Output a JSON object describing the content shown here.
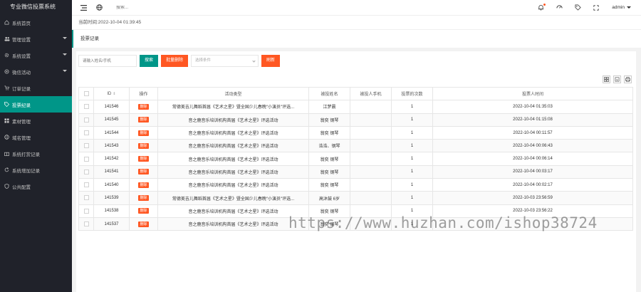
{
  "sidebar": {
    "title": "专业微信投票系统",
    "items": [
      {
        "label": "系统首页",
        "icon": "home-icon",
        "arrow": false,
        "active": false
      },
      {
        "label": "管理设置",
        "icon": "users-icon",
        "arrow": true,
        "active": false
      },
      {
        "label": "系统设置",
        "icon": "gear-icon",
        "arrow": true,
        "active": false
      },
      {
        "label": "微信活动",
        "icon": "settings-icon",
        "arrow": true,
        "active": false
      },
      {
        "label": "订单记录",
        "icon": "cart-icon",
        "arrow": false,
        "active": false
      },
      {
        "label": "投票纪录",
        "icon": "tag-icon",
        "arrow": false,
        "active": true
      },
      {
        "label": "素材管理",
        "icon": "grid-icon",
        "arrow": false,
        "active": false
      },
      {
        "label": "域名管理",
        "icon": "globe-icon",
        "arrow": false,
        "active": false
      },
      {
        "label": "系统打赏记录",
        "icon": "gift-icon",
        "arrow": false,
        "active": false
      },
      {
        "label": "系统增加记录",
        "icon": "refresh-icon",
        "arrow": false,
        "active": false
      },
      {
        "label": "公共配置",
        "icon": "shield-icon",
        "arrow": false,
        "active": false
      }
    ]
  },
  "topbar": {
    "search_placeholder": "搜索...",
    "user": "admin"
  },
  "timebar": {
    "text": "当前时间:2022-10-04 01:39:45"
  },
  "tab": {
    "label": "投票记录"
  },
  "filter": {
    "name_placeholder": "请输入姓名/手机",
    "search_label": "搜索",
    "batch_delete_label": "批量删除",
    "select_placeholder": "选择条件",
    "refresh_label": "刷新"
  },
  "table": {
    "headers": [
      "ID",
      "操作",
      "活动类型",
      "被投姓名",
      "被投人手机",
      "投票的次数",
      "投票人时间"
    ],
    "delete_label": "删除",
    "rows": [
      {
        "id": "141546",
        "activity": "常德美吉儿舞蹈首届《艺术之星》暨全国少儿春晚\"小演员\"评选...",
        "name": "江梦晨",
        "phone": "",
        "count": "1",
        "time": "2022-10-04 01:35:03"
      },
      {
        "id": "141545",
        "activity": "音之鹿音乐培训机构首届《艺术之星》评选活动",
        "name": "翁奕 钢琴",
        "phone": "",
        "count": "1",
        "time": "2022-10-04 01:15:08"
      },
      {
        "id": "141544",
        "activity": "音之鹿音乐培训机构首届《艺术之星》评选活动",
        "name": "翁奕 钢琴",
        "phone": "",
        "count": "1",
        "time": "2022-10-04 00:11:57"
      },
      {
        "id": "141543",
        "activity": "音之鹿音乐培训机构首届《艺术之星》评选活动",
        "name": "浩浩、钢琴",
        "phone": "",
        "count": "1",
        "time": "2022-10-04 00:06:43"
      },
      {
        "id": "141542",
        "activity": "音之鹿音乐培训机构首届《艺术之星》评选活动",
        "name": "翁奕 钢琴",
        "phone": "",
        "count": "1",
        "time": "2022-10-04 00:06:14"
      },
      {
        "id": "141541",
        "activity": "音之鹿音乐培训机构首届《艺术之星》评选活动",
        "name": "翁奕 钢琴",
        "phone": "",
        "count": "1",
        "time": "2022-10-04 00:03:17"
      },
      {
        "id": "141540",
        "activity": "音之鹿音乐培训机构首届《艺术之星》评选活动",
        "name": "翁奕 钢琴",
        "phone": "",
        "count": "1",
        "time": "2022-10-04 00:02:17"
      },
      {
        "id": "141539",
        "activity": "常德美吉儿舞蹈首届《艺术之星》暨全国少儿春晚\"小演员\"评选...",
        "name": "高沐鼓 6岁",
        "phone": "",
        "count": "1",
        "time": "2022-10-03 23:56:59"
      },
      {
        "id": "141538",
        "activity": "音之鹿音乐培训机构首届《艺术之星》评选活动",
        "name": "翁奕 钢琴",
        "phone": "",
        "count": "1",
        "time": "2022-10-03 23:56:22"
      },
      {
        "id": "141537",
        "activity": "音之鹿音乐培训机构首届《艺术之星》评选活动",
        "name": "翁奕 钢琴",
        "phone": "",
        "count": "1",
        "time": ""
      }
    ]
  },
  "watermark": "https://www.huzhan.com/ishop38724",
  "colors": {
    "accent": "#009688",
    "danger": "#ff5722",
    "sidebar": "#20222a"
  }
}
